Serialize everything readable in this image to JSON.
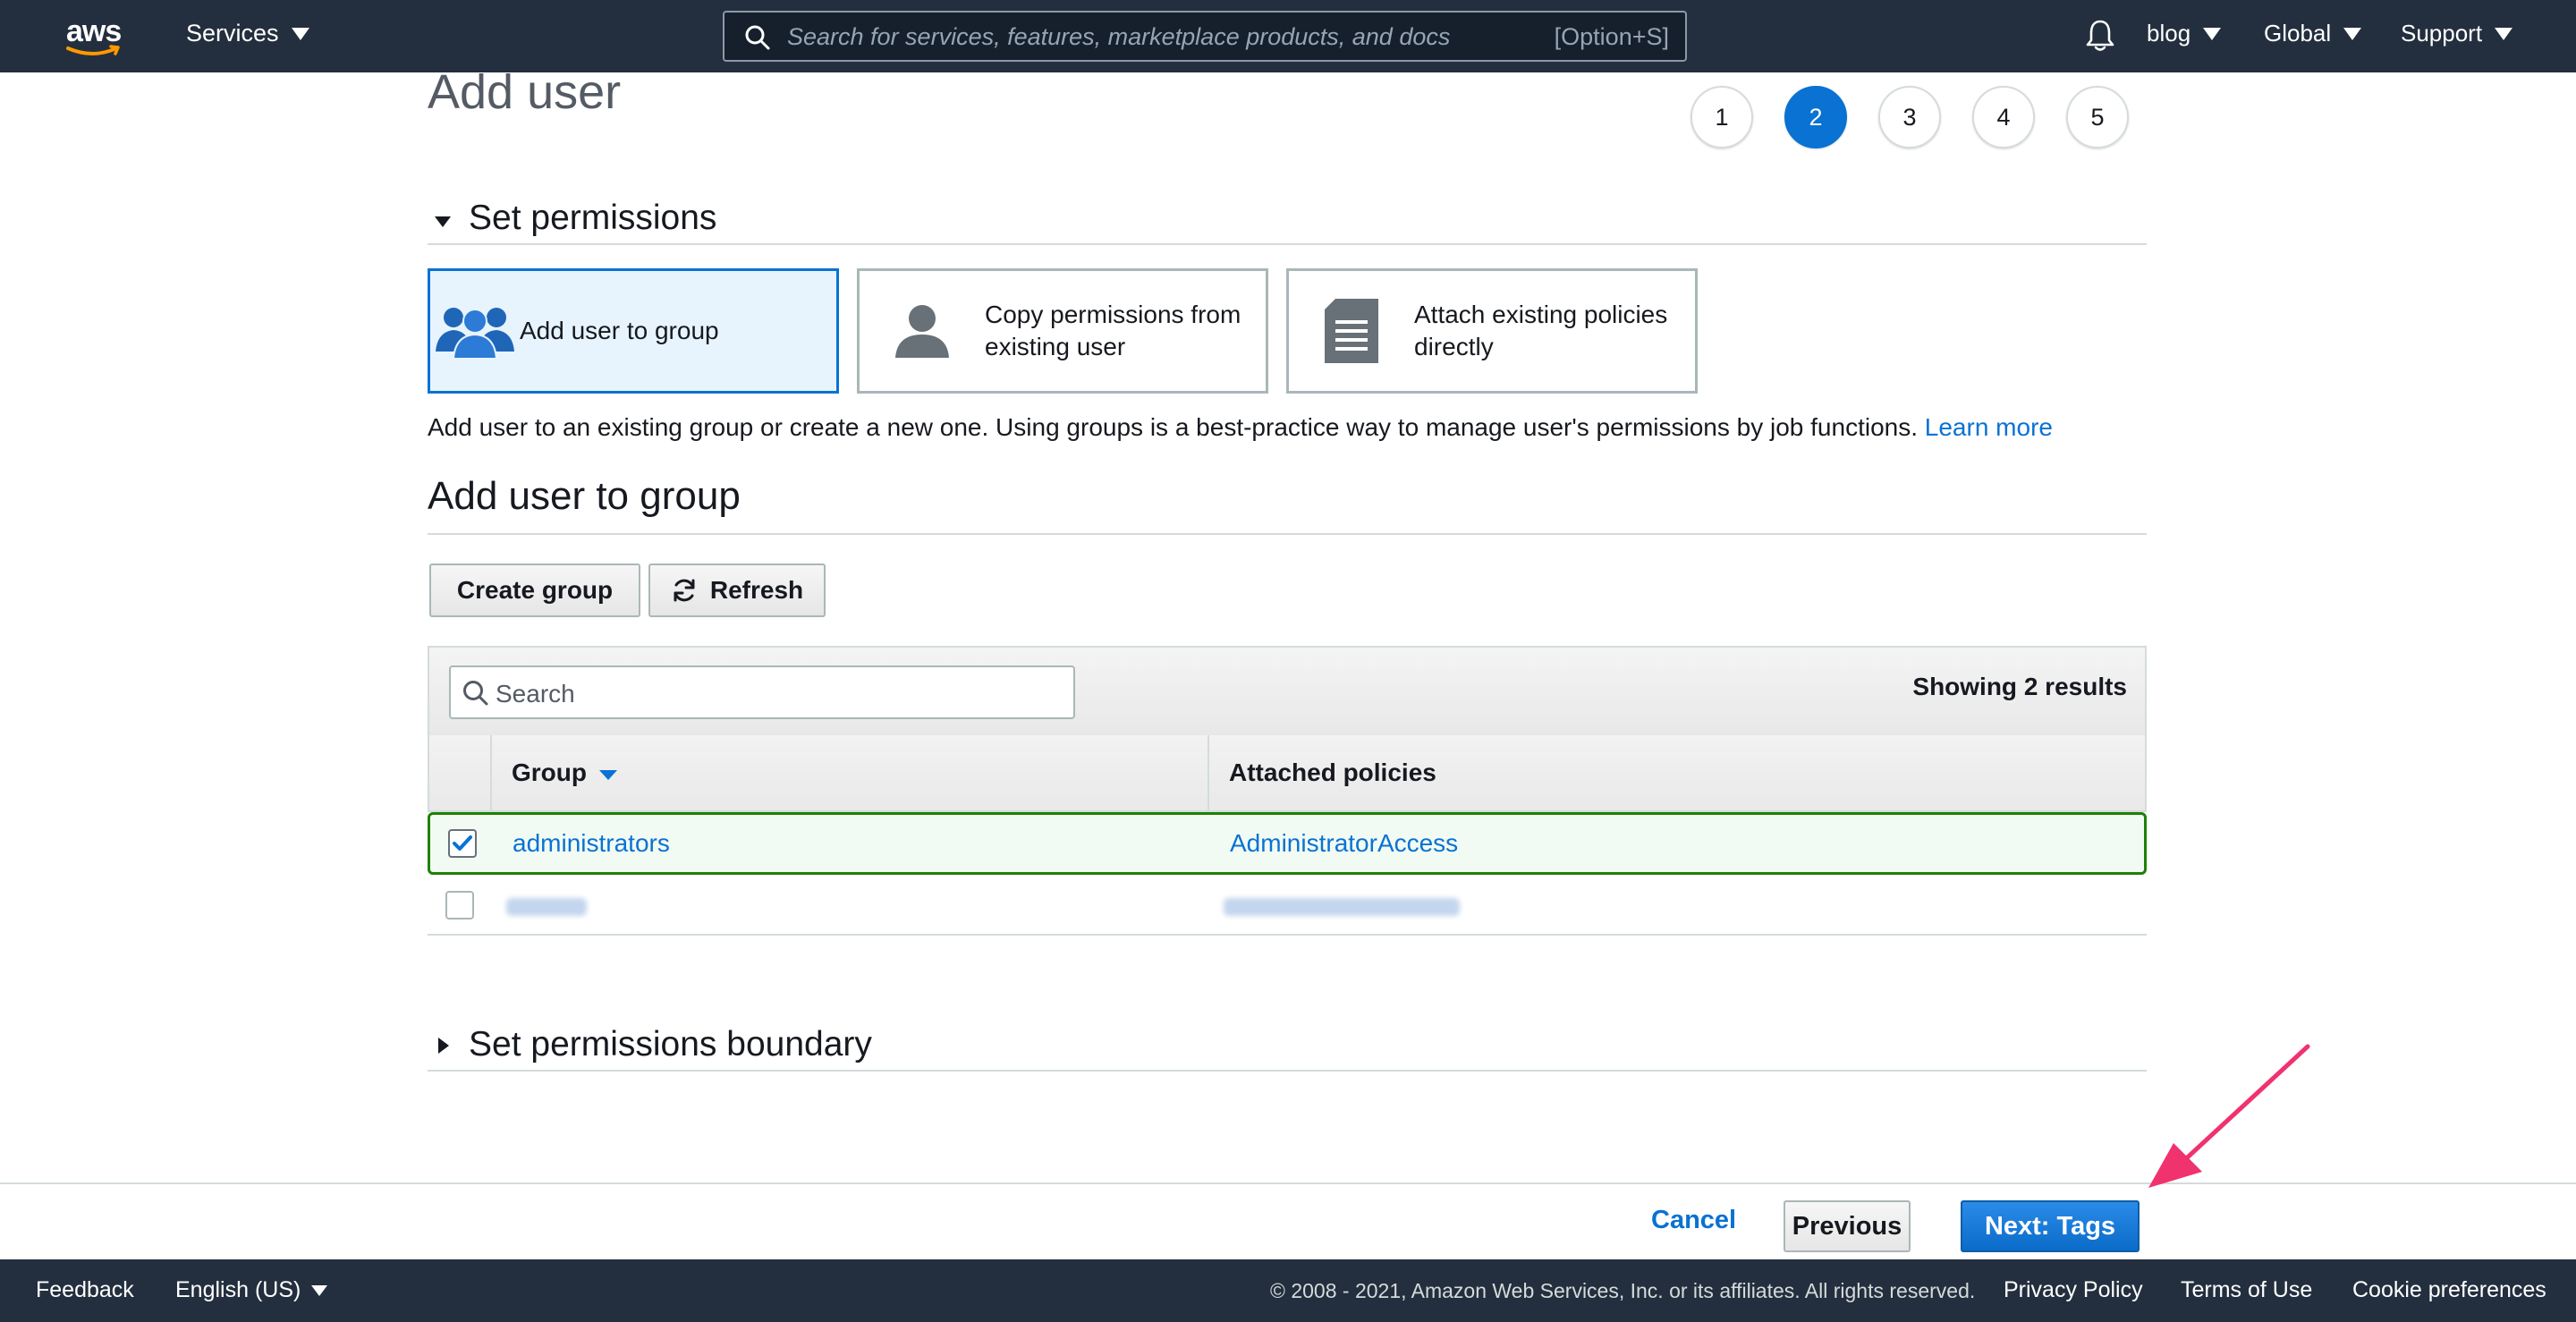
{
  "topnav": {
    "logo_text": "aws",
    "services_label": "Services",
    "search_placeholder": "Search for services, features, marketplace products, and docs",
    "search_shortcut": "[Option+S]",
    "account_label": "blog",
    "region_label": "Global",
    "support_label": "Support"
  },
  "page": {
    "title": "Add user",
    "steps": [
      "1",
      "2",
      "3",
      "4",
      "5"
    ],
    "active_step": "2"
  },
  "permissions": {
    "section_title": "Set permissions",
    "options": [
      {
        "label": "Add user to group",
        "icon": "users-group-icon",
        "selected": true
      },
      {
        "label": "Copy permissions from existing user",
        "icon": "user-icon",
        "selected": false
      },
      {
        "label": "Attach existing policies directly",
        "icon": "document-icon",
        "selected": false
      }
    ],
    "description": "Add user to an existing group or create a new one. Using groups is a best-practice way to manage user's permissions by job functions.",
    "learn_more": "Learn more"
  },
  "group_section": {
    "title": "Add user to group",
    "create_group_label": "Create group",
    "refresh_label": "Refresh",
    "search_placeholder": "Search",
    "results_text": "Showing 2 results",
    "columns": {
      "group": "Group",
      "policies": "Attached policies"
    },
    "rows": [
      {
        "group": "administrators",
        "policies": "AdministratorAccess",
        "checked": true
      },
      {
        "group": "",
        "policies": "",
        "checked": false
      }
    ]
  },
  "boundary": {
    "section_title": "Set permissions boundary"
  },
  "actions": {
    "cancel_label": "Cancel",
    "previous_label": "Previous",
    "next_label": "Next: Tags"
  },
  "footer": {
    "feedback_label": "Feedback",
    "language_label": "English (US)",
    "copyright": "© 2008 - 2021, Amazon Web Services, Inc. or its affiliates. All rights reserved.",
    "privacy_label": "Privacy Policy",
    "terms_label": "Terms of Use",
    "cookie_label": "Cookie preferences"
  },
  "colors": {
    "nav_bg": "#232f3e",
    "accent": "#0972d3",
    "selected_row_border": "#1d8102",
    "annotation_arrow": "#f0326e"
  }
}
